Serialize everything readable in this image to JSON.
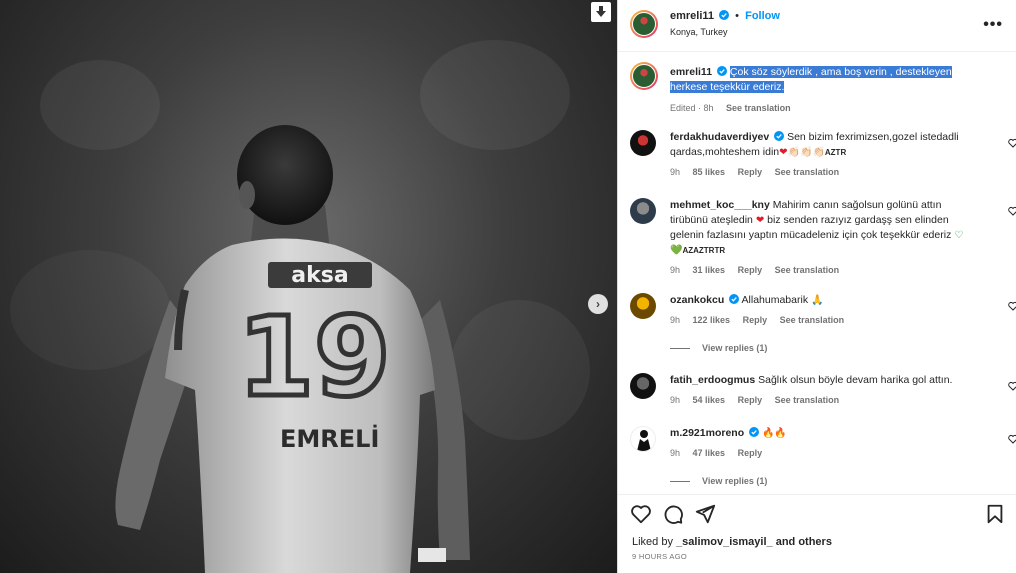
{
  "post": {
    "username": "emreli11",
    "follow_label": "Follow",
    "location": "Konya, Turkey",
    "more_label": "•••",
    "jersey_brand": "aksa",
    "jersey_number": "19",
    "jersey_name": "EMRELİ"
  },
  "caption": {
    "username": "emreli11",
    "text": "Çok söz söylerdik , ama boş verin , destekleyen herkese teşekkür ederiz.",
    "edited": "Edited · 8h",
    "see_translation": "See translation"
  },
  "comments": [
    {
      "username": "ferdakhudaverdiyev",
      "verified": true,
      "text": "Sen bizim fexrimizsen,gozel istedadli qardas,mohteshem idin",
      "emoji": "❤👏🏻👏🏻👏🏻",
      "suffix": "AZTR",
      "time": "9h",
      "likes": "85 likes",
      "reply": "Reply",
      "translate": "See translation"
    },
    {
      "username": "mehmet_koc___kny",
      "verified": false,
      "text": "Mahirim canın sağolsun golünü attın tirübünü ateşledin",
      "text2": "biz senden razıyız gardaşş sen elinden gelenin fazlasını yaptın mücadeleniz için çok teşekkür ederiz",
      "emoji": "♡💚",
      "suffix": "AZAZTRTR",
      "time": "9h",
      "likes": "31 likes",
      "reply": "Reply",
      "translate": "See translation"
    },
    {
      "username": "ozankokcu",
      "verified": true,
      "text": "Allahumabarik",
      "emoji": "🙏",
      "time": "9h",
      "likes": "122 likes",
      "reply": "Reply",
      "translate": "See translation",
      "view_replies": "View replies (1)"
    },
    {
      "username": "fatih_erdoogmus",
      "verified": false,
      "text": "Sağlık olsun böyle devam harika gol attın.",
      "time": "9h",
      "likes": "54 likes",
      "reply": "Reply",
      "translate": "See translation"
    },
    {
      "username": "m.2921moreno",
      "verified": true,
      "text": "",
      "emoji": "🔥🔥",
      "time": "9h",
      "likes": "47 likes",
      "reply": "Reply",
      "view_replies": "View replies (1)"
    }
  ],
  "footer": {
    "liked_prefix": "Liked by ",
    "liked_user": "_salimov_ismayil_",
    "liked_suffix": " and others",
    "timestamp": "9 HOURS AGO"
  },
  "icons": [
    "save-icon",
    "next-icon",
    "more-icon",
    "verified-icon",
    "heart-icon",
    "comment-icon",
    "share-icon",
    "bookmark-icon"
  ],
  "colors": {
    "accent": "#0095f6",
    "verified": "#0095f6",
    "highlight": "#3a7bd5",
    "muted": "#737373"
  }
}
